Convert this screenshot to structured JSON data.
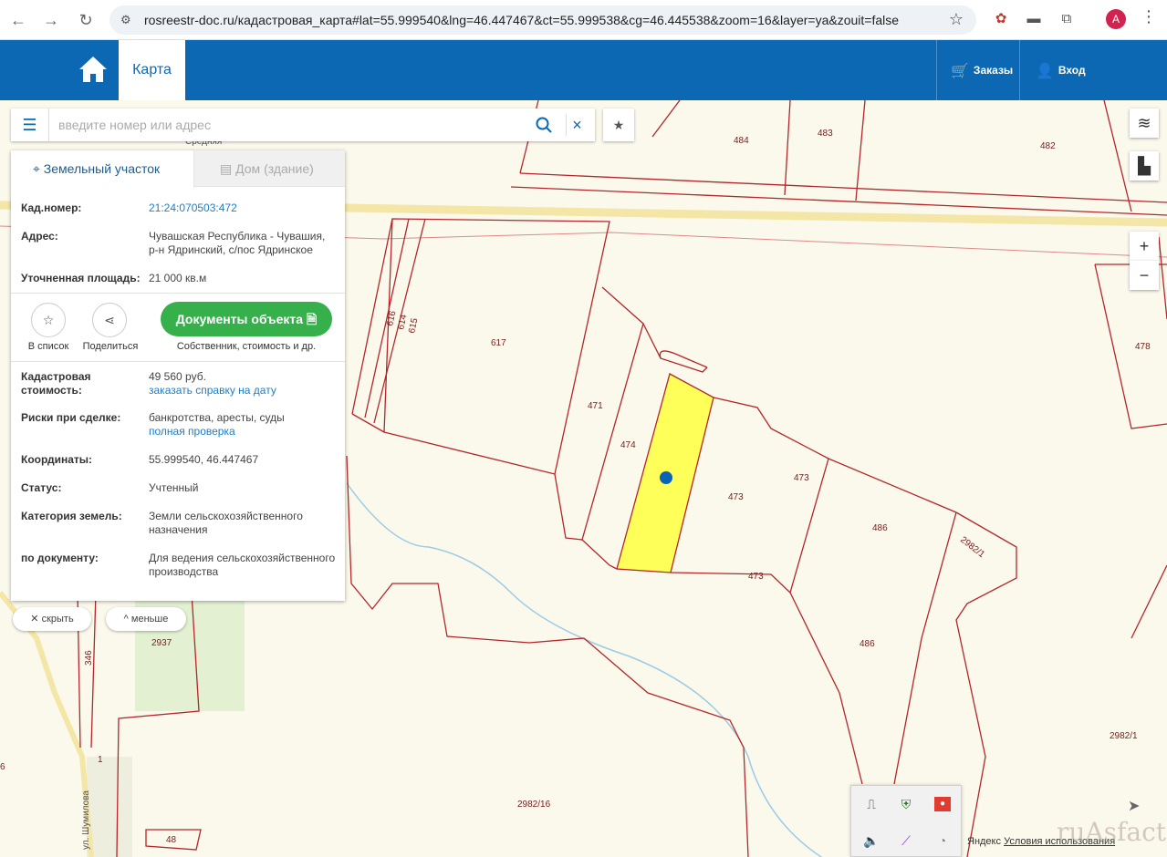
{
  "browser": {
    "url": "rosreestr-doc.ru/кадастровая_карта#lat=55.999540&lng=46.447467&ct=55.999538&cg=46.445538&zoom=16&layer=ya&zouit=false",
    "profile_initial": "A"
  },
  "header": {
    "tab_map": "Карта",
    "orders": "Заказы",
    "login": "Вход",
    "brand_color": "#0d68b3"
  },
  "search": {
    "placeholder": "введите номер или адрес"
  },
  "panel": {
    "tab_land": "Земельный участок",
    "tab_house": "Дом (здание)",
    "kad_label": "Кад.номер:",
    "kad_value": "21:24:070503:472",
    "addr_label": "Адрес:",
    "addr_value": "Чувашская Республика - Чувашия, р-н Ядринский, с/пос Ядринское",
    "area_label": "Уточненная площадь:",
    "area_value": "21 000 кв.м",
    "fav_caption": "В список",
    "share_caption": "Поделиться",
    "docs_button": "Документы объекта",
    "docs_caption": "Собственник, стоимость и др.",
    "cost_label": "Кадастровая стоимость:",
    "cost_value": "49 560 руб.",
    "cost_link": "заказать справку на дату",
    "risk_label": "Риски при сделке:",
    "risk_value": "банкротства, аресты, суды",
    "risk_link": "полная проверка",
    "coord_label": "Координаты:",
    "coord_value": "55.999540, 46.447467",
    "status_label": "Статус:",
    "status_value": "Учтенный",
    "cat_label": "Категория земель:",
    "cat_value": "Земли сельскохозяйственного назначения",
    "doc_label": "по документу:",
    "doc_value": "Для ведения сельскохозяйственного производства",
    "accent_green": "#35b04a"
  },
  "map_buttons": {
    "hide": "скрыть",
    "less": "меньше",
    "zoom_in": "+",
    "zoom_out": "−"
  },
  "map_labels": {
    "p484": "484",
    "p483": "483",
    "p482": "482",
    "p617": "617",
    "p616": "616",
    "p614": "614",
    "p615": "615",
    "p471": "471",
    "p474": "474",
    "p473a": "473",
    "p473b": "473",
    "p473c": "473",
    "p478": "478",
    "p486a": "486",
    "p486b": "486",
    "p2982_1a": "2982/1",
    "p2982_1b": "2982/1",
    "p2982_16": "2982/16",
    "p2937": "2937",
    "p346": "346",
    "p48": "48",
    "street": "ул. Шумилова",
    "p1": "1",
    "p6": "6",
    "frag_sred": "Средняя"
  },
  "attribution": {
    "prefix": "Яндекс",
    "link": "Условия использования"
  },
  "watermark": "ruAsfactory"
}
